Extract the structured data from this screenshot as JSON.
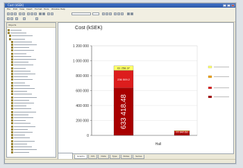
{
  "window": {
    "title": "Cost (kSEK)"
  },
  "menu": [
    "File",
    "Edit",
    "View",
    "Insert",
    "Format",
    "Tools",
    "Window",
    "Help"
  ],
  "sidebar": {
    "header": "Objects",
    "items": [
      "",
      "",
      "",
      "",
      "",
      "",
      "",
      "",
      "",
      "",
      "",
      "",
      "",
      "",
      "",
      "",
      "",
      "",
      "",
      "",
      "",
      "",
      "",
      "",
      "",
      "",
      "",
      "",
      "",
      "",
      "",
      "",
      "",
      "",
      "",
      "",
      "",
      "",
      "",
      "",
      "",
      "",
      ""
    ]
  },
  "tabs": [
    {
      "label": "Graphs"
    },
    {
      "label": "Info"
    },
    {
      "label": "Data"
    },
    {
      "label": "Type"
    },
    {
      "label": "Notes"
    },
    {
      "label": "Series"
    }
  ],
  "small_panel": {
    "line1": "",
    "line2": ""
  },
  "chart_data": {
    "type": "bar",
    "title": "Cost (kSEK)",
    "xlabel": "Hall",
    "ylabel": "",
    "ylim": [
      0,
      1200000
    ],
    "yticks": [
      "0",
      "200 000",
      "400 000",
      "600 000",
      "800 000",
      "1 000 000",
      "1 200 000"
    ],
    "categories": [
      "",
      ""
    ],
    "series": [
      {
        "name": "",
        "color": "#a80000",
        "values": [
          633418.48,
          35000
        ]
      },
      {
        "name": "",
        "color": "#dd1d1d",
        "values": [
          236509,
          24000
        ]
      },
      {
        "name": "",
        "color": "#ffff66",
        "values": [
          61258.37,
          0
        ]
      },
      {
        "name": "",
        "color": "#f0a000",
        "values": [
          0,
          4000
        ]
      }
    ],
    "bar_labels": [
      [
        "633 418.48",
        "236 509.2",
        "61 258.37"
      ],
      [
        "",
        "77 047.52",
        ""
      ]
    ]
  },
  "colors": {
    "titlebar": "#2c58a8",
    "frame": "#ece9d8",
    "accent_red": "#cc1111",
    "accent_yellow": "#ffff66"
  }
}
